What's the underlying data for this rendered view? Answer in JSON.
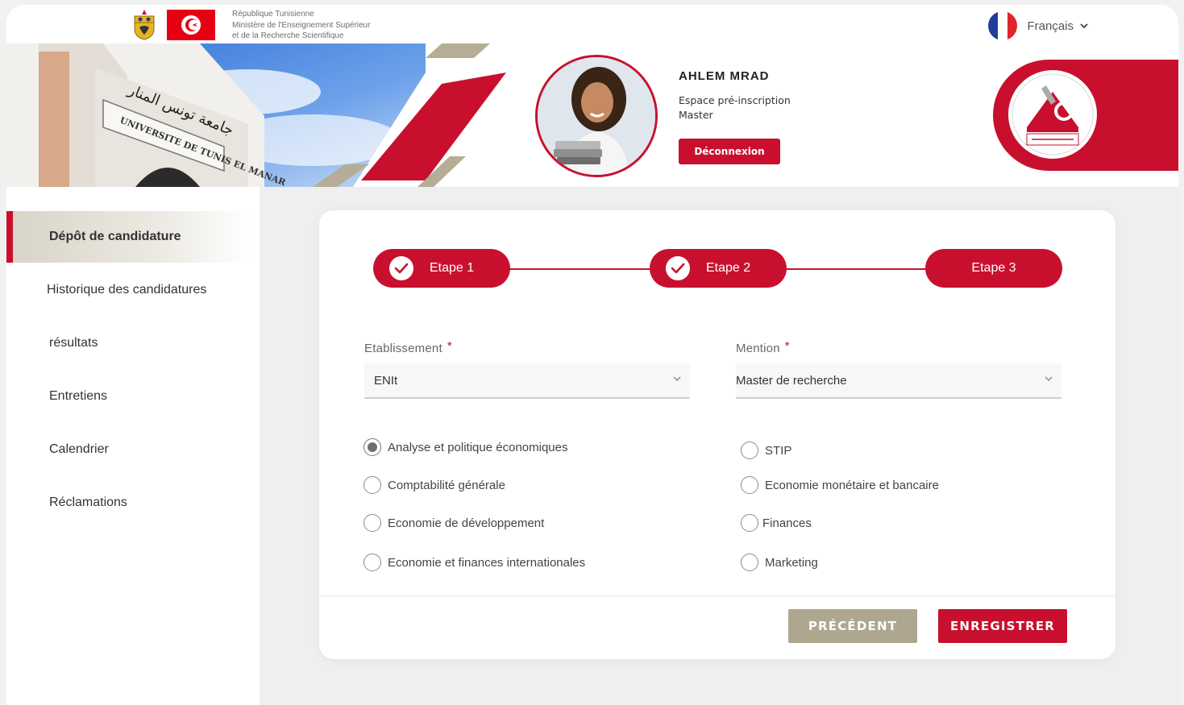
{
  "header": {
    "ministry_line1": "République Tunisienne",
    "ministry_line2": "Ministère de l'Enseignement Supérieur",
    "ministry_line3": "et de la Recherche Scientifique",
    "language": "Français"
  },
  "user": {
    "name": "AHLEM  MRAD",
    "space_line1": "Espace pré-inscription",
    "space_line2": "Master",
    "logout_label": "Déconnexion"
  },
  "sidebar": {
    "items": [
      {
        "label": "Dépôt de candidature",
        "active": true
      },
      {
        "label": "Historique des candidatures",
        "active": false
      },
      {
        "label": "résultats",
        "active": false
      },
      {
        "label": "Entretiens",
        "active": false
      },
      {
        "label": "Calendrier",
        "active": false
      },
      {
        "label": "Réclamations",
        "active": false
      }
    ]
  },
  "stepper": {
    "steps": [
      {
        "label": "Etape 1",
        "done": true
      },
      {
        "label": "Etape 2",
        "done": true
      },
      {
        "label": "Etape 3",
        "done": false
      }
    ]
  },
  "form": {
    "etablissement": {
      "label": "Etablissement",
      "required_mark": "*",
      "value": "ENIt"
    },
    "mention": {
      "label": "Mention",
      "required_mark": "*",
      "value": "Master de recherche"
    },
    "options_left": [
      {
        "label": "Analyse et politique économiques",
        "checked": true
      },
      {
        "label": "Comptabilité générale",
        "checked": false
      },
      {
        "label": "Economie de développement",
        "checked": false
      },
      {
        "label": "Economie et finances internationales",
        "checked": false
      }
    ],
    "options_right": [
      {
        "label": "STIP",
        "checked": false
      },
      {
        "label": "Economie monétaire et bancaire",
        "checked": false
      },
      {
        "label": "Finances",
        "checked": false
      },
      {
        "label": "Marketing",
        "checked": false
      }
    ]
  },
  "actions": {
    "previous_label": "PRÉCÉDENT",
    "save_label": "ENREGISTRER"
  },
  "colors": {
    "primary_red": "#c8102e",
    "secondary_beige": "#aea68e"
  }
}
